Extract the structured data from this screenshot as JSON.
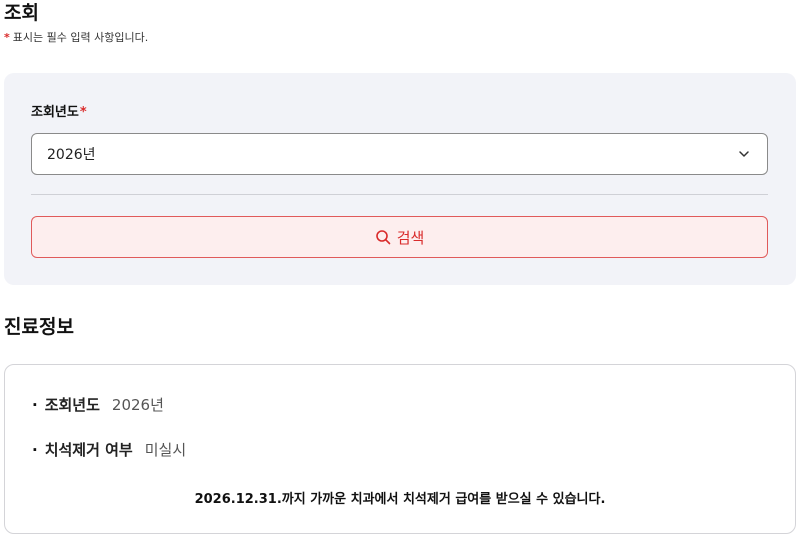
{
  "search_section": {
    "title": "조회",
    "required_mark": "*",
    "required_note": "표시는 필수 입력 사항입니다.",
    "year_field": {
      "label": "조회년도",
      "required_mark": "*",
      "selected_value": "2026년"
    },
    "search_button": {
      "label": "검색",
      "icon": "search-icon"
    }
  },
  "info_section": {
    "title": "진료정보",
    "bullet": "·",
    "rows": [
      {
        "label": "조회년도",
        "value": "2026년"
      },
      {
        "label": "치석제거 여부",
        "value": "미실시"
      }
    ],
    "notice": "2026.12.31.까지 가까운 치과에서 치석제거 급여를 받으실 수 있습니다."
  },
  "colors": {
    "accent": "#d92b2b",
    "panel_bg": "#f2f3f8",
    "button_bg": "#fdeeee"
  }
}
